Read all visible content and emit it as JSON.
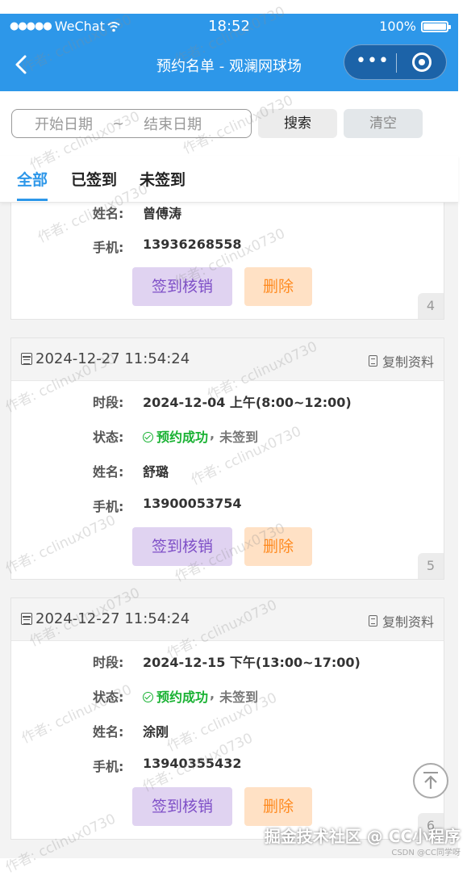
{
  "statusbar": {
    "carrier": "WeChat",
    "time": "18:52",
    "battery": "100%"
  },
  "navbar": {
    "title": "预约名单 - 观澜网球场"
  },
  "search": {
    "start_placeholder": "开始日期",
    "separator": "~",
    "end_placeholder": "结束日期",
    "search_label": "搜索",
    "clear_label": "清空"
  },
  "tabs": [
    {
      "label": "全部"
    },
    {
      "label": "已签到"
    },
    {
      "label": "未签到"
    }
  ],
  "cards": [
    {
      "name_label": "姓名:",
      "name": "曾傅涛",
      "phone_label": "手机:",
      "phone": "13936268558",
      "checkin_label": "签到核销",
      "delete_label": "删除",
      "index": "4"
    },
    {
      "datetime": "2024-12-27 11:54:24",
      "copy_label": "复制资料",
      "period_label": "时段:",
      "period": "2024-12-04 上午(8:00~12:00)",
      "status_label": "状态:",
      "status_ok": "预约成功",
      "status_sep": ",",
      "status_sign": "未签到",
      "name_label": "姓名:",
      "name": "舒璐",
      "phone_label": "手机:",
      "phone": "13900053754",
      "checkin_label": "签到核销",
      "delete_label": "删除",
      "index": "5"
    },
    {
      "datetime": "2024-12-27 11:54:24",
      "copy_label": "复制资料",
      "period_label": "时段:",
      "period": "2024-12-15 下午(13:00~17:00)",
      "status_label": "状态:",
      "status_ok": "预约成功",
      "status_sep": ",",
      "status_sign": "未签到",
      "name_label": "姓名:",
      "name": "涂刚",
      "phone_label": "手机:",
      "phone": "13940355432",
      "checkin_label": "签到核销",
      "delete_label": "删除",
      "index": "6"
    }
  ],
  "watermark": {
    "text": "作者: cclinux0730"
  },
  "footer": {
    "text": "掘金技术社区 @ CC小程序",
    "csdn": "CSDN @CC同学呀"
  },
  "colors": {
    "primary": "#2d97e9",
    "checkin_bg": "#e0d3f1",
    "delete_bg": "#ffe1c5",
    "success": "#19b233"
  }
}
